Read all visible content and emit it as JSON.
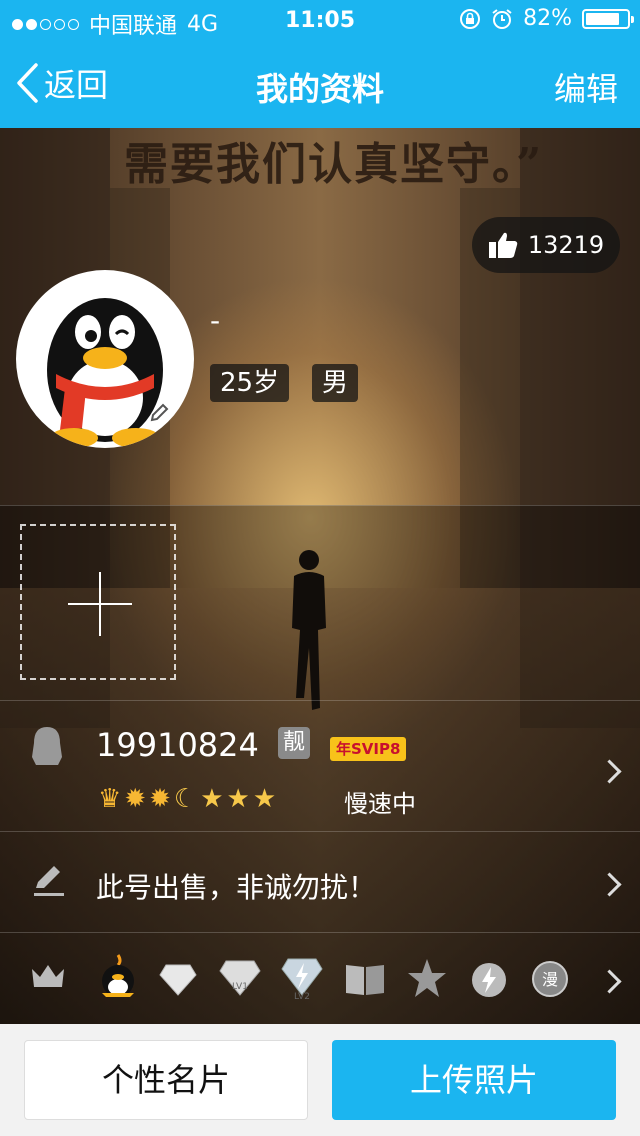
{
  "status_bar": {
    "carrier": "中国联通",
    "network": "4G",
    "time": "11:05",
    "battery": "82%",
    "battery_level": 0.82,
    "signal_filled": 2,
    "signal_total": 5
  },
  "nav": {
    "back_label": "返回",
    "title": "我的资料",
    "edit_label": "编辑"
  },
  "hero": {
    "quote": "需要我们认真坚守。”"
  },
  "profile": {
    "likes": "13219",
    "nickname": "-",
    "age": "25岁",
    "gender": "男"
  },
  "account": {
    "qq_number": "19910824",
    "liang_badge": "靓",
    "svip_badge": "年SVIP8",
    "level_status": "慢速中"
  },
  "signature": {
    "text": "此号出售，非诚勿扰！"
  },
  "buttons": {
    "card": "个性名片",
    "upload": "上传照片"
  },
  "colors": {
    "accent": "#1bb5f0"
  }
}
